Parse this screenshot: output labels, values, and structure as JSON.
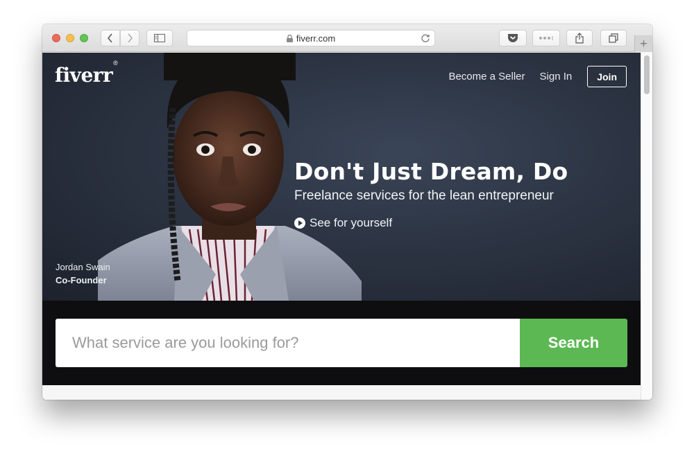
{
  "browser": {
    "url": "fiverr.com",
    "new_tab_glyph": "+",
    "icons": {
      "back": "chevron-left-icon",
      "forward": "chevron-right-icon",
      "sidebar": "sidebar-icon",
      "lock": "lock-icon",
      "reload": "reload-icon",
      "pocket": "pocket-icon",
      "extensions": "more-dots-icon",
      "share": "share-icon",
      "tabs": "tabs-overview-icon"
    }
  },
  "header": {
    "logo": "fiverr",
    "logo_mark": "®",
    "nav": {
      "become_seller": "Become a Seller",
      "sign_in": "Sign In",
      "join": "Join"
    }
  },
  "hero": {
    "headline": "Don't Just Dream, Do",
    "subheadline": "Freelance services for the lean entrepreneur",
    "video_link": "See for yourself",
    "caption_name": "Jordan Swain",
    "caption_role": "Co-Founder"
  },
  "search": {
    "placeholder": "What service are you looking for?",
    "value": "",
    "button_label": "Search",
    "button_color": "#5cb852"
  },
  "colors": {
    "hero_bg": "#2c3443",
    "search_band": "#0e0e10"
  }
}
